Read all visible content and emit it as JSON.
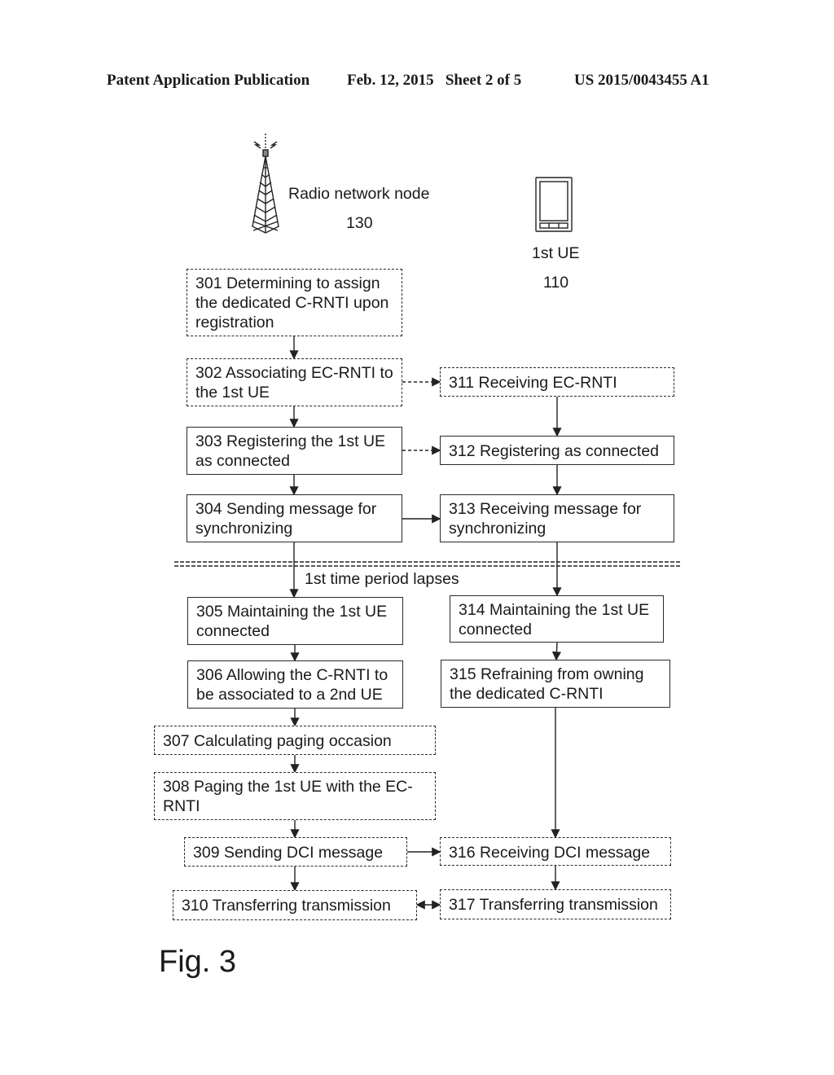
{
  "header": {
    "left": "Patent Application Publication",
    "date_sheet": "Feb. 12, 2015   Sheet 2 of 5",
    "number": "US 2015/0043455 A1"
  },
  "actors": {
    "node": {
      "icon": "radio-tower-icon",
      "name": "Radio network node",
      "ref": "130"
    },
    "ue": {
      "icon": "mobile-phone-icon",
      "name": "1st UE",
      "ref": "110"
    }
  },
  "steps": {
    "s301": "301 Determining to assign the dedicated C-RNTI upon registration",
    "s302": "302 Associating EC-RNTI to the 1st UE",
    "s303": "303 Registering the 1st UE as connected",
    "s304": "304 Sending message for synchronizing",
    "s305": "305 Maintaining the 1st UE connected",
    "s306": "306 Allowing the C-RNTI to be associated to a 2nd UE",
    "s307": "307 Calculating paging occasion",
    "s308": "308 Paging the 1st UE with the EC-RNTI",
    "s309": "309 Sending DCI message",
    "s310": "310 Transferring transmission",
    "s311": "311 Receiving EC-RNTI",
    "s312": "312 Registering as connected",
    "s313": "313 Receiving message for synchronizing",
    "s314": "314 Maintaining the 1st UE connected",
    "s315": "315 Refraining from owning the dedicated C-RNTI",
    "s316": "316 Receiving DCI message",
    "s317": "317 Transferring transmission"
  },
  "time_separator_label": "1st time period lapses",
  "figure_label": "Fig. 3"
}
